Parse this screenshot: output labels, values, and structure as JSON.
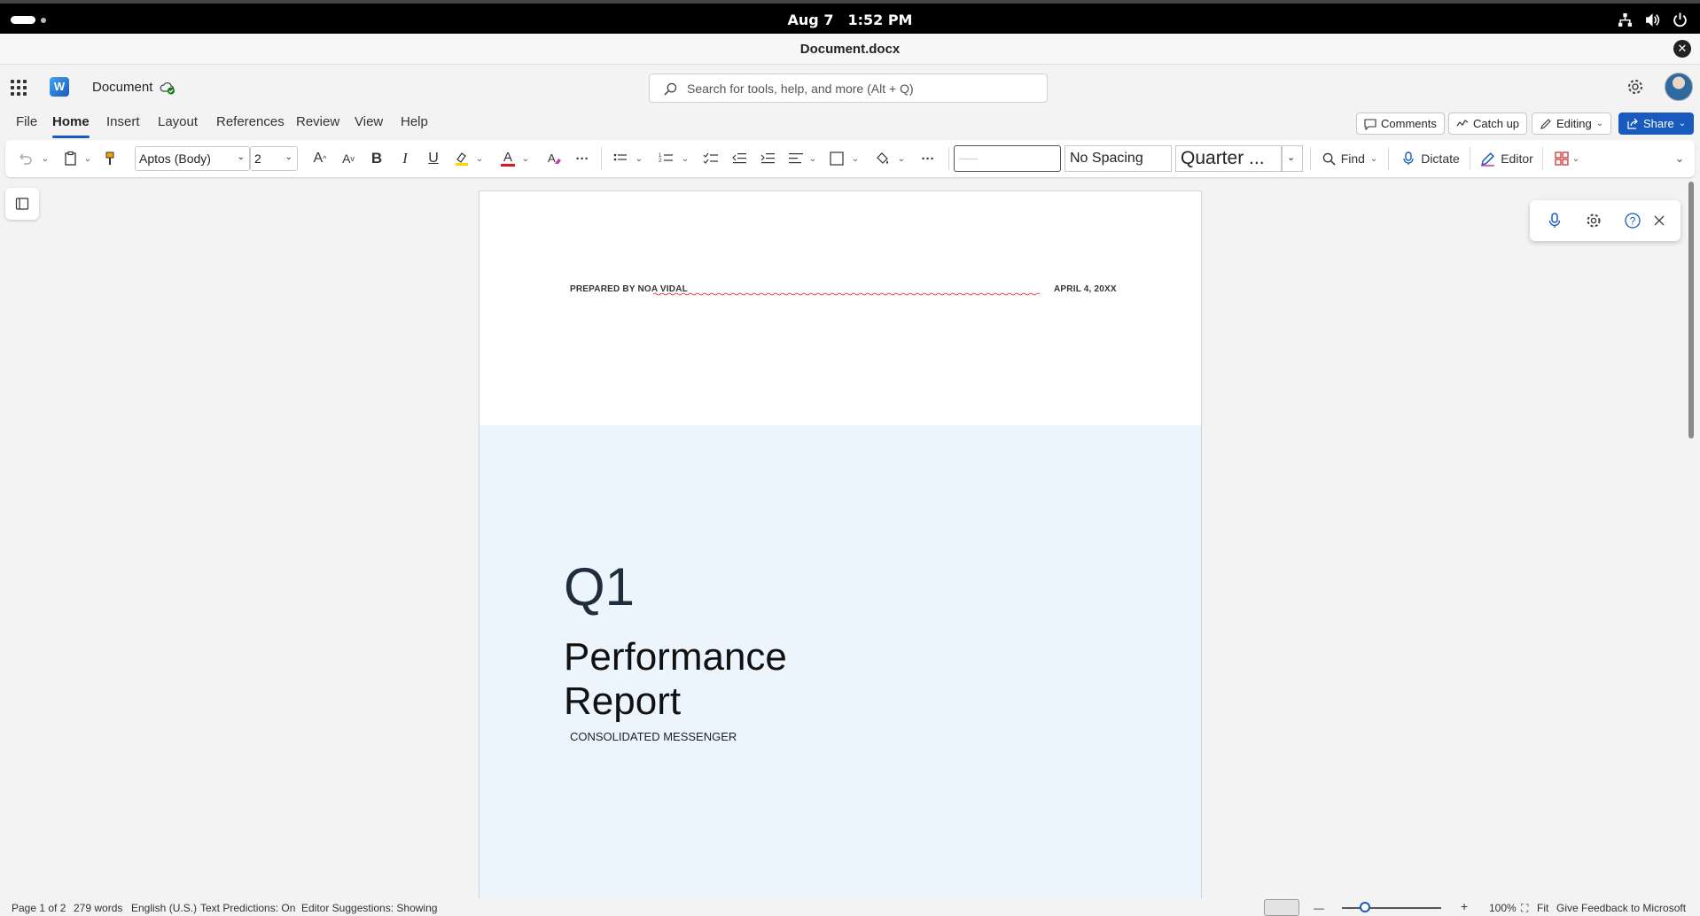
{
  "os": {
    "date": "Aug 7",
    "time": "1:52 PM"
  },
  "window": {
    "title": "Document.docx",
    "close_label": "✕"
  },
  "app": {
    "logo_letter": "W",
    "doc_name": "Document",
    "search_placeholder": "Search for tools, help, and more (Alt + Q)"
  },
  "menu": {
    "tabs": [
      "File",
      "Home",
      "Insert",
      "Layout",
      "References",
      "Review",
      "View",
      "Help"
    ],
    "active": "Home",
    "comments": "Comments",
    "catchup": "Catch up",
    "editing": "Editing",
    "share": "Share"
  },
  "ribbon": {
    "font": "Aptos (Body)",
    "size": "2",
    "style_1": "-------",
    "style_2": "No Spacing",
    "style_3": "Quarter ...",
    "find": "Find",
    "dictate": "Dictate",
    "editor": "Editor",
    "more": "···"
  },
  "document": {
    "prepared_by": "PREPARED BY NOA VIDAL",
    "date": "APRIL 4, 20XX",
    "q": "Q1",
    "title_line1": "Performance",
    "title_line2": "Report",
    "subtitle": "CONSOLIDATED MESSENGER",
    "cover_color": "#edf5fc"
  },
  "status": {
    "page": "Page 1 of 2",
    "words": "279 words",
    "language": "English (U.S.)",
    "predictions": "Text Predictions: On",
    "suggestions": "Editor Suggestions: Showing",
    "zoom_minus": "—",
    "zoom_plus": "+",
    "zoom": "100%",
    "fit": "Fit",
    "feedback": "Give Feedback to Microsoft"
  },
  "colors": {
    "accent": "#185abd",
    "font_color": "#e81123",
    "highlight": "#ffd400"
  }
}
